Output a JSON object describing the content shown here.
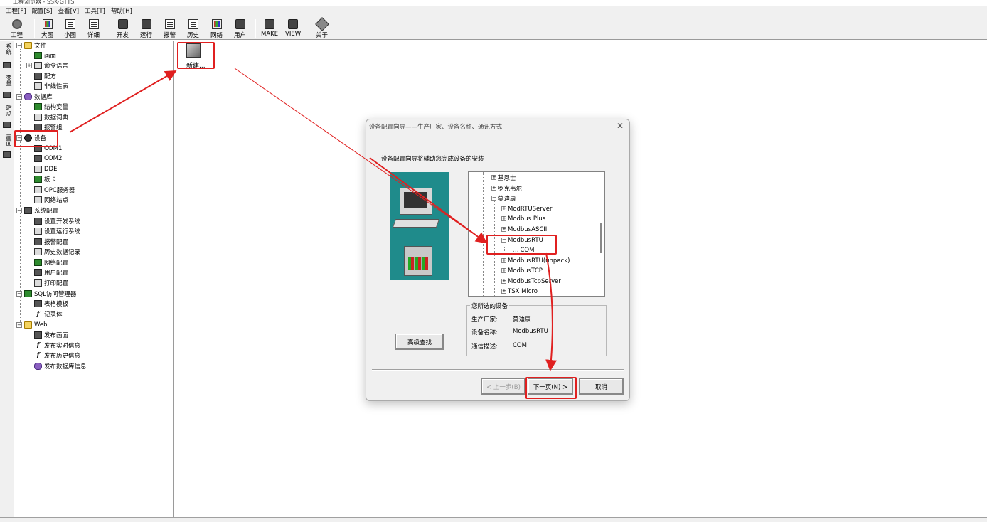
{
  "window": {
    "title": "工程浏览器 - SSK-GTTS"
  },
  "menu": [
    "工程[F]",
    "配置[S]",
    "查看[V]",
    "工具[T]",
    "帮助[H]"
  ],
  "toolbar": [
    "工程",
    "大图",
    "小图",
    "详细",
    "开发",
    "运行",
    "报警",
    "历史",
    "网络",
    "用户",
    "MAKE",
    "VIEW",
    "关于"
  ],
  "side_tabs": [
    "系统",
    "变量",
    "站点",
    "画面"
  ],
  "tree": {
    "file": "文件",
    "screen": "画面",
    "cmd_lang": "命令语言",
    "recipe": "配方",
    "nonlinear": "非线性表",
    "database": "数据库",
    "struct_var": "结构变量",
    "data_dict": "数据词典",
    "alarm_group": "报警组",
    "device": "设备",
    "com1": "COM1",
    "com2": "COM2",
    "dde": "DDE",
    "board": "板卡",
    "opc": "OPC服务器",
    "net_station": "网络站点",
    "sys_config": "系统配置",
    "dev_sys": "设置开发系统",
    "run_sys": "设置运行系统",
    "alarm_cfg": "报警配置",
    "hist_cfg": "历史数据记录",
    "net_cfg": "网络配置",
    "user_cfg": "用户配置",
    "print_cfg": "打印配置",
    "sql": "SQL访问管理器",
    "table_tpl": "表格模板",
    "record": "记录体",
    "web": "Web",
    "pub_screen": "发布画面",
    "pub_rt": "发布实时信息",
    "pub_hist": "发布历史信息",
    "pub_db": "发布数据库信息"
  },
  "content": {
    "new_label": "新建..."
  },
  "dialog": {
    "title": "设备配置向导——生产厂家、设备名称、通讯方式",
    "intro": "设备配置向导将辅助您完成设备的安装",
    "devtree": [
      "基恩士",
      "罗克韦尔",
      "莫迪康",
      "ModRTUServer",
      "Modbus Plus",
      "ModbusASCII",
      "ModbusRTU",
      "COM",
      "ModbusRTU(unpack)",
      "ModbusTCP",
      "ModbusTcpServer",
      "TSX Micro"
    ],
    "selected_group": "您所选的设备",
    "maker_label": "生产厂家:",
    "maker_value": "莫迪康",
    "name_label": "设备名称:",
    "name_value": "ModbusRTU",
    "comm_label": "通信描述:",
    "comm_value": "COM",
    "adv_search": "高级查找",
    "prev": "< 上一步(B)",
    "next": "下一页(N) >",
    "cancel": "取消"
  },
  "colors": {
    "highlight": "#e02020",
    "illustration_bg": "#1f8b8b"
  }
}
